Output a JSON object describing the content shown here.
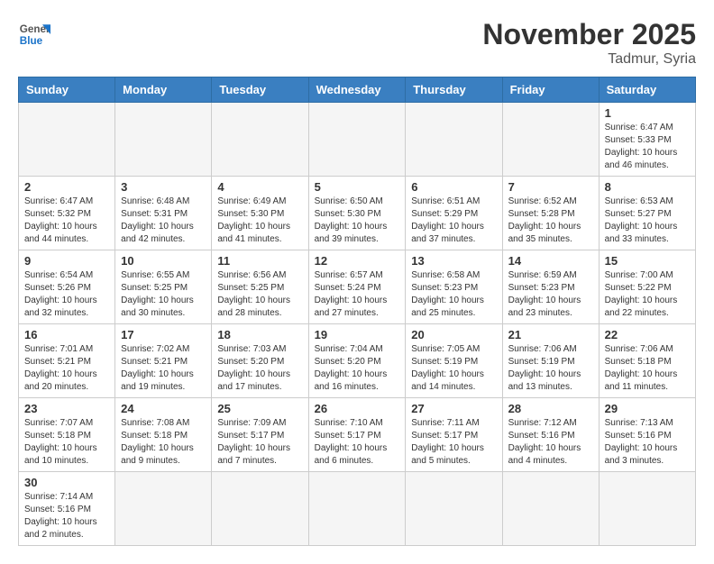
{
  "logo": {
    "text_general": "General",
    "text_blue": "Blue"
  },
  "header": {
    "month": "November 2025",
    "location": "Tadmur, Syria"
  },
  "weekdays": [
    "Sunday",
    "Monday",
    "Tuesday",
    "Wednesday",
    "Thursday",
    "Friday",
    "Saturday"
  ],
  "weeks": [
    [
      {
        "day": "",
        "info": ""
      },
      {
        "day": "",
        "info": ""
      },
      {
        "day": "",
        "info": ""
      },
      {
        "day": "",
        "info": ""
      },
      {
        "day": "",
        "info": ""
      },
      {
        "day": "",
        "info": ""
      },
      {
        "day": "1",
        "info": "Sunrise: 6:47 AM\nSunset: 5:33 PM\nDaylight: 10 hours\nand 46 minutes."
      }
    ],
    [
      {
        "day": "2",
        "info": "Sunrise: 6:47 AM\nSunset: 5:32 PM\nDaylight: 10 hours\nand 44 minutes."
      },
      {
        "day": "3",
        "info": "Sunrise: 6:48 AM\nSunset: 5:31 PM\nDaylight: 10 hours\nand 42 minutes."
      },
      {
        "day": "4",
        "info": "Sunrise: 6:49 AM\nSunset: 5:30 PM\nDaylight: 10 hours\nand 41 minutes."
      },
      {
        "day": "5",
        "info": "Sunrise: 6:50 AM\nSunset: 5:30 PM\nDaylight: 10 hours\nand 39 minutes."
      },
      {
        "day": "6",
        "info": "Sunrise: 6:51 AM\nSunset: 5:29 PM\nDaylight: 10 hours\nand 37 minutes."
      },
      {
        "day": "7",
        "info": "Sunrise: 6:52 AM\nSunset: 5:28 PM\nDaylight: 10 hours\nand 35 minutes."
      },
      {
        "day": "8",
        "info": "Sunrise: 6:53 AM\nSunset: 5:27 PM\nDaylight: 10 hours\nand 33 minutes."
      }
    ],
    [
      {
        "day": "9",
        "info": "Sunrise: 6:54 AM\nSunset: 5:26 PM\nDaylight: 10 hours\nand 32 minutes."
      },
      {
        "day": "10",
        "info": "Sunrise: 6:55 AM\nSunset: 5:25 PM\nDaylight: 10 hours\nand 30 minutes."
      },
      {
        "day": "11",
        "info": "Sunrise: 6:56 AM\nSunset: 5:25 PM\nDaylight: 10 hours\nand 28 minutes."
      },
      {
        "day": "12",
        "info": "Sunrise: 6:57 AM\nSunset: 5:24 PM\nDaylight: 10 hours\nand 27 minutes."
      },
      {
        "day": "13",
        "info": "Sunrise: 6:58 AM\nSunset: 5:23 PM\nDaylight: 10 hours\nand 25 minutes."
      },
      {
        "day": "14",
        "info": "Sunrise: 6:59 AM\nSunset: 5:23 PM\nDaylight: 10 hours\nand 23 minutes."
      },
      {
        "day": "15",
        "info": "Sunrise: 7:00 AM\nSunset: 5:22 PM\nDaylight: 10 hours\nand 22 minutes."
      }
    ],
    [
      {
        "day": "16",
        "info": "Sunrise: 7:01 AM\nSunset: 5:21 PM\nDaylight: 10 hours\nand 20 minutes."
      },
      {
        "day": "17",
        "info": "Sunrise: 7:02 AM\nSunset: 5:21 PM\nDaylight: 10 hours\nand 19 minutes."
      },
      {
        "day": "18",
        "info": "Sunrise: 7:03 AM\nSunset: 5:20 PM\nDaylight: 10 hours\nand 17 minutes."
      },
      {
        "day": "19",
        "info": "Sunrise: 7:04 AM\nSunset: 5:20 PM\nDaylight: 10 hours\nand 16 minutes."
      },
      {
        "day": "20",
        "info": "Sunrise: 7:05 AM\nSunset: 5:19 PM\nDaylight: 10 hours\nand 14 minutes."
      },
      {
        "day": "21",
        "info": "Sunrise: 7:06 AM\nSunset: 5:19 PM\nDaylight: 10 hours\nand 13 minutes."
      },
      {
        "day": "22",
        "info": "Sunrise: 7:06 AM\nSunset: 5:18 PM\nDaylight: 10 hours\nand 11 minutes."
      }
    ],
    [
      {
        "day": "23",
        "info": "Sunrise: 7:07 AM\nSunset: 5:18 PM\nDaylight: 10 hours\nand 10 minutes."
      },
      {
        "day": "24",
        "info": "Sunrise: 7:08 AM\nSunset: 5:18 PM\nDaylight: 10 hours\nand 9 minutes."
      },
      {
        "day": "25",
        "info": "Sunrise: 7:09 AM\nSunset: 5:17 PM\nDaylight: 10 hours\nand 7 minutes."
      },
      {
        "day": "26",
        "info": "Sunrise: 7:10 AM\nSunset: 5:17 PM\nDaylight: 10 hours\nand 6 minutes."
      },
      {
        "day": "27",
        "info": "Sunrise: 7:11 AM\nSunset: 5:17 PM\nDaylight: 10 hours\nand 5 minutes."
      },
      {
        "day": "28",
        "info": "Sunrise: 7:12 AM\nSunset: 5:16 PM\nDaylight: 10 hours\nand 4 minutes."
      },
      {
        "day": "29",
        "info": "Sunrise: 7:13 AM\nSunset: 5:16 PM\nDaylight: 10 hours\nand 3 minutes."
      }
    ],
    [
      {
        "day": "30",
        "info": "Sunrise: 7:14 AM\nSunset: 5:16 PM\nDaylight: 10 hours\nand 2 minutes."
      },
      {
        "day": "",
        "info": ""
      },
      {
        "day": "",
        "info": ""
      },
      {
        "day": "",
        "info": ""
      },
      {
        "day": "",
        "info": ""
      },
      {
        "day": "",
        "info": ""
      },
      {
        "day": "",
        "info": ""
      }
    ]
  ]
}
